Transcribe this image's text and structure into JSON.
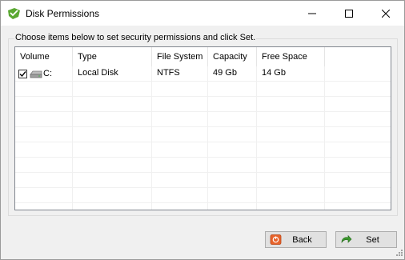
{
  "window": {
    "title": "Disk Permissions",
    "icons": {
      "app": "green-shield-icon",
      "minimize": "minimize-icon",
      "maximize": "maximize-icon",
      "close": "close-icon"
    }
  },
  "group": {
    "caption": "Choose items below to set security permissions and click Set."
  },
  "table": {
    "columns": [
      "Volume",
      "Type",
      "File System",
      "Capacity",
      "Free Space"
    ],
    "rows": [
      {
        "checked": true,
        "icon": "drive-icon",
        "volume": "C:",
        "type": "Local Disk",
        "file_system": "NTFS",
        "capacity": "49 Gb",
        "free_space": "14 Gb"
      }
    ]
  },
  "buttons": {
    "back": {
      "label": "Back",
      "icon": "back-icon"
    },
    "set": {
      "label": "Set",
      "icon": "set-arrow-icon"
    }
  },
  "colors": {
    "window_bg": "#f0f0f0",
    "button_bg": "#e1e1e1",
    "list_border": "#828790"
  }
}
